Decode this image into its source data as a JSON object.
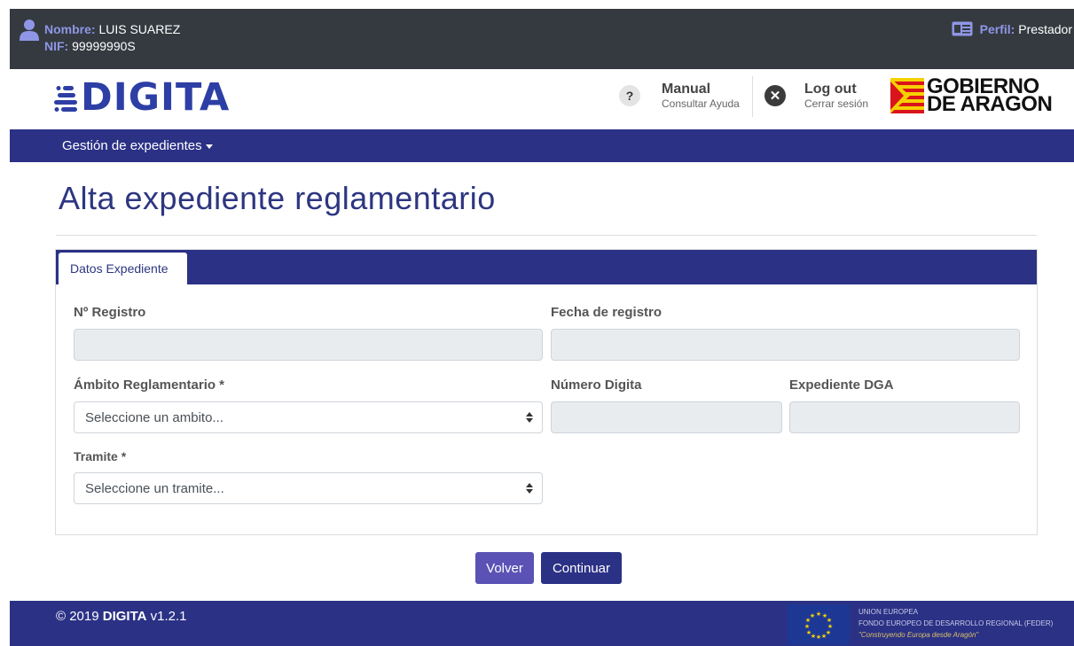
{
  "topbar": {
    "name_label": "Nombre:",
    "name_value": "LUIS SUAREZ",
    "nif_label": "NIF:",
    "nif_value": "99999990S",
    "profile_label": "Perfil:",
    "profile_value": "Prestador"
  },
  "header": {
    "logo_text": "DIGITA",
    "manual_title": "Manual",
    "manual_sub": "Consultar Ayuda",
    "logout_title": "Log out",
    "logout_sub": "Cerrar sesión",
    "gov_line1": "GOBIERNO",
    "gov_line2": "DE ARAGON"
  },
  "nav": {
    "menu_label": "Gestión de expedientes"
  },
  "page": {
    "title": "Alta expediente reglamentario",
    "tab_label": "Datos Expediente"
  },
  "form": {
    "registro_label": "Nº Registro",
    "registro_value": "",
    "fecha_label": "Fecha de registro",
    "fecha_value": "",
    "ambito_label": "Ámbito Reglamentario *",
    "ambito_placeholder": "Seleccione un ambito...",
    "numero_label": "Número Digita",
    "numero_value": "",
    "dga_label": "Expediente DGA",
    "dga_value": "",
    "tramite_label": "Tramite *",
    "tramite_placeholder": "Seleccione un tramite..."
  },
  "actions": {
    "back_label": "Volver",
    "continue_label": "Continuar"
  },
  "footer": {
    "copyright_prefix": "© 2019",
    "brand": "DIGITA",
    "version": "v1.2.1",
    "eu_line1": "UNION EUROPEA",
    "eu_line2": "FONDO EUROPEO DE DESARROLLO REGIONAL (FEDER)",
    "eu_line3": "\"Construyendo Europa desde Aragón\""
  },
  "colors": {
    "navy": "#2b3185",
    "topbar": "#343a40",
    "title_blue": "#2d3680",
    "accent_label": "#8f96e6",
    "back_button": "#5a53b5"
  },
  "icons": [
    "user-icon",
    "id-card-icon",
    "help-icon",
    "close-icon",
    "caret-down-icon",
    "select-arrows-icon",
    "eu-flag-icon",
    "aragon-flag-icon"
  ]
}
